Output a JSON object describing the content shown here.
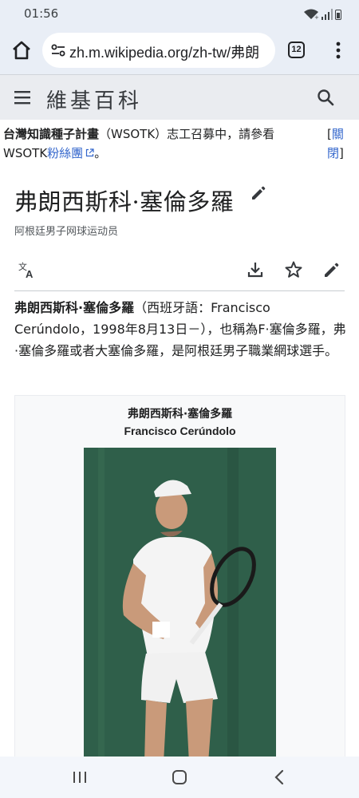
{
  "status_bar": {
    "time": "01:56"
  },
  "browser": {
    "url": "zh.m.wikipedia.org/zh-tw/弗朗",
    "tab_count": "12"
  },
  "header": {
    "logo": "維基百科"
  },
  "notice": {
    "bold_text": "台灣知識種子計畫",
    "text_after": "（WSOTK）志工召募中，請參看",
    "line2_prefix": "WSOTK",
    "link": "粉絲團",
    "line2_suffix": "。",
    "close_open": "[",
    "close_label1": "關",
    "close_label2": "閉",
    "close_end": "]"
  },
  "page": {
    "title": "弗朗西斯科·塞倫多羅",
    "tagline": "阿根廷男子网球运动员"
  },
  "intro": {
    "bold_name": "弗朗西斯科·塞倫多羅",
    "text": "（西班牙語：Francisco Cerúndolo，1998年8月13日－），也稱為F·塞倫多羅，弗·塞倫多羅或者大塞倫多羅，是阿根廷男子職業網球選手。"
  },
  "infobox": {
    "title_zh": "弗朗西斯科·塞倫多羅",
    "title_en": "Francisco Cerúndolo"
  },
  "icons": {
    "home": "home-icon",
    "site_info": "tune-icon",
    "menu": "more-vert-icon",
    "hamburger": "menu-icon",
    "search": "search-icon",
    "edit": "pencil-icon",
    "language": "translate-icon",
    "download": "download-icon",
    "watch": "star-icon"
  },
  "colors": {
    "link": "#3366cc",
    "chrome_bg": "#e9eef6",
    "wiki_header_bg": "#eaecf0",
    "photo_bg": "#2f5f4a"
  }
}
